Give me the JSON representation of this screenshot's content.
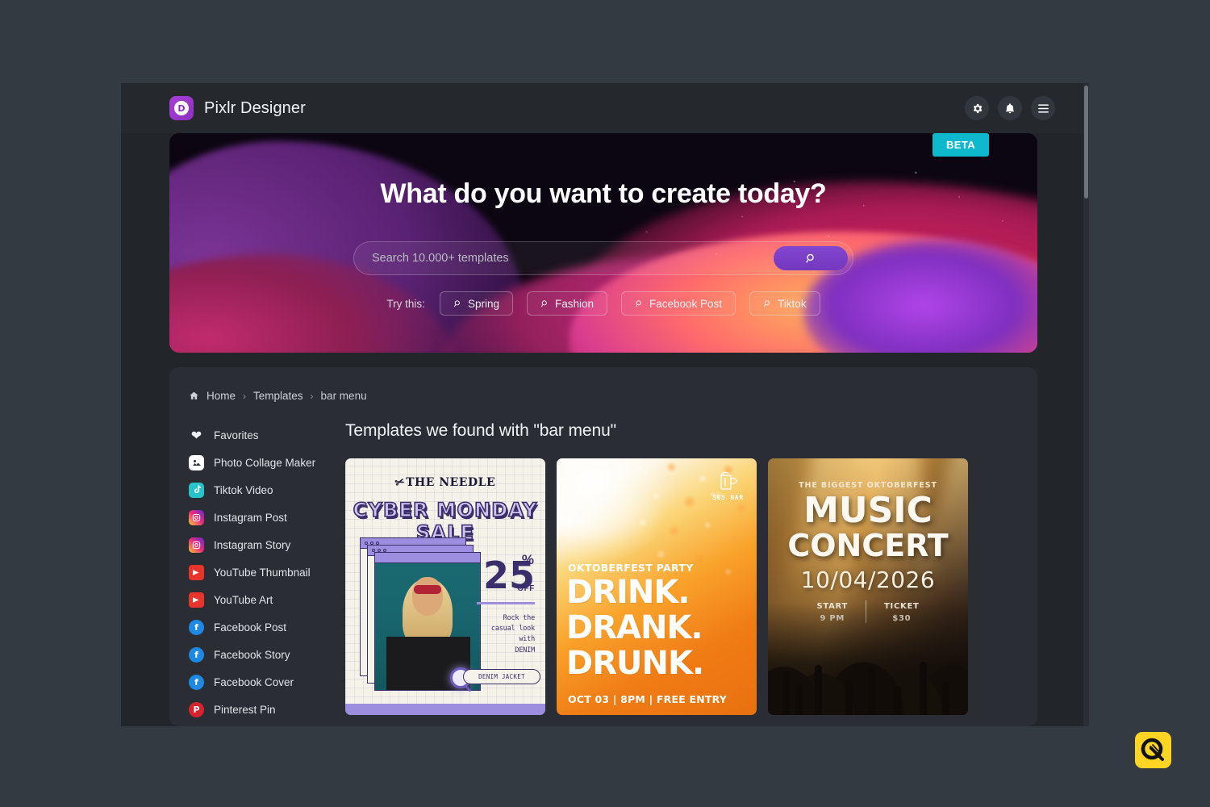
{
  "app": {
    "brand_initial": "D",
    "brand_name": "Pixlr Designer"
  },
  "topbar": {
    "settings_icon": "gear-icon",
    "notifications_icon": "bell-icon",
    "menu_icon": "hamburger-menu-icon"
  },
  "hero": {
    "badge": "BETA",
    "title": "What do you want to create today?",
    "search": {
      "placeholder": "Search 10.000+ templates",
      "value": "",
      "button_icon": "search-icon"
    },
    "try_label": "Try this:",
    "chips": [
      {
        "label": "Spring",
        "icon": "search-icon"
      },
      {
        "label": "Fashion",
        "icon": "search-icon"
      },
      {
        "label": "Facebook Post",
        "icon": "search-icon"
      },
      {
        "label": "Tiktok",
        "icon": "search-icon"
      }
    ]
  },
  "breadcrumb": {
    "home_icon": "home-icon",
    "items": [
      "Home",
      "Templates",
      "bar menu"
    ],
    "separator": "›"
  },
  "sidebar": {
    "items": [
      {
        "label": "Favorites",
        "icon": "heart-icon"
      },
      {
        "label": "Photo Collage Maker",
        "icon": "collage-icon"
      },
      {
        "label": "Tiktok Video",
        "icon": "tiktok-icon"
      },
      {
        "label": "Instagram Post",
        "icon": "instagram-icon"
      },
      {
        "label": "Instagram Story",
        "icon": "instagram-icon"
      },
      {
        "label": "YouTube Thumbnail",
        "icon": "youtube-icon"
      },
      {
        "label": "YouTube Art",
        "icon": "youtube-icon"
      },
      {
        "label": "Facebook Post",
        "icon": "facebook-icon"
      },
      {
        "label": "Facebook Story",
        "icon": "facebook-icon"
      },
      {
        "label": "Facebook Cover",
        "icon": "facebook-icon"
      },
      {
        "label": "Pinterest Pin",
        "icon": "pinterest-icon"
      }
    ]
  },
  "results": {
    "title": "Templates we found with \"bar menu\"",
    "query": "bar menu",
    "cards": [
      {
        "id": "cyber-monday-sale",
        "brand": "THE NEEDLE",
        "headline": "CYBER MONDAY SALE",
        "discount_number": "25",
        "discount_symbol": "%",
        "discount_label": "OFF",
        "tagline": "Rock the\ncasual look with\nDENIM",
        "tagline_line1": "Rock the",
        "tagline_line2": "casual look with",
        "tagline_line3": "DENIM",
        "search_pill": "DENIM JACKET"
      },
      {
        "id": "oktoberfest-drink",
        "logo_label": "SUS BAR",
        "logo_icon": "beer-mug-icon",
        "kicker": "OKTOBERFEST PARTY",
        "line1": "DRINK.",
        "line2": "DRANK.",
        "line3": "DRUNK.",
        "footer": "OCT 03 | 8PM | FREE ENTRY"
      },
      {
        "id": "music-concert",
        "kicker": "THE BIGGEST OKTOBERFEST",
        "line1": "MUSIC",
        "line2": "CONCERT",
        "date": "10/04/2026",
        "info_left_label": "START",
        "info_left_value": "9 PM",
        "info_right_label": "TICKET",
        "info_right_value": "$30"
      }
    ]
  },
  "colors": {
    "accent_purple": "#7a3fc4",
    "beta_cyan": "#0eb8cd",
    "window_bg": "#22262b",
    "panel_bg": "#2a2e34",
    "page_bg": "#343a42"
  }
}
